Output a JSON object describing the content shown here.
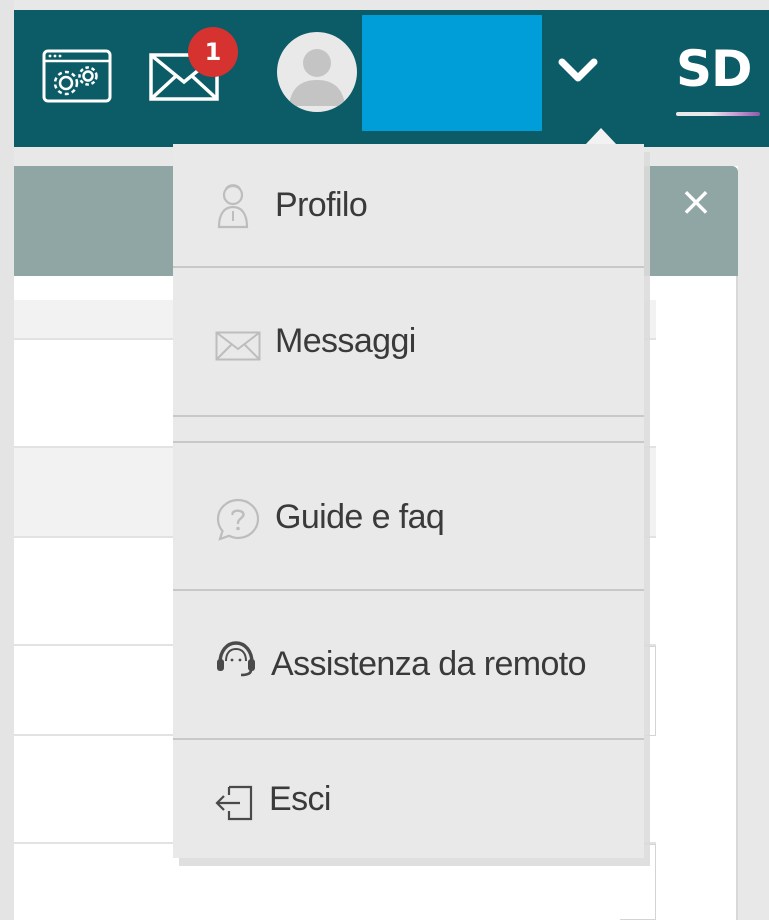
{
  "header": {
    "settings_icon": "settings-gears-icon",
    "mail_icon": "envelope-icon",
    "mail_badge_count": "1",
    "user_avatar_icon": "user-avatar-icon",
    "dropdown_toggle_icon": "chevron-down-icon",
    "logo_text": "SD",
    "colors": {
      "bar": "#0b5c66",
      "badge": "#d6322f",
      "user_block": "#009ed8"
    }
  },
  "panel": {
    "close_icon": "close-icon",
    "close_glyph": "×",
    "header_color": "#8fa6a4"
  },
  "menu": {
    "items": [
      {
        "label": "Profilo",
        "icon": "user-icon"
      },
      {
        "label": "Messaggi",
        "icon": "envelope-icon"
      },
      {
        "label": "Guide e faq",
        "icon": "question-bubble-icon"
      },
      {
        "label": "Assistenza da remoto",
        "icon": "headset-icon"
      },
      {
        "label": "Esci",
        "icon": "logout-icon"
      }
    ]
  }
}
